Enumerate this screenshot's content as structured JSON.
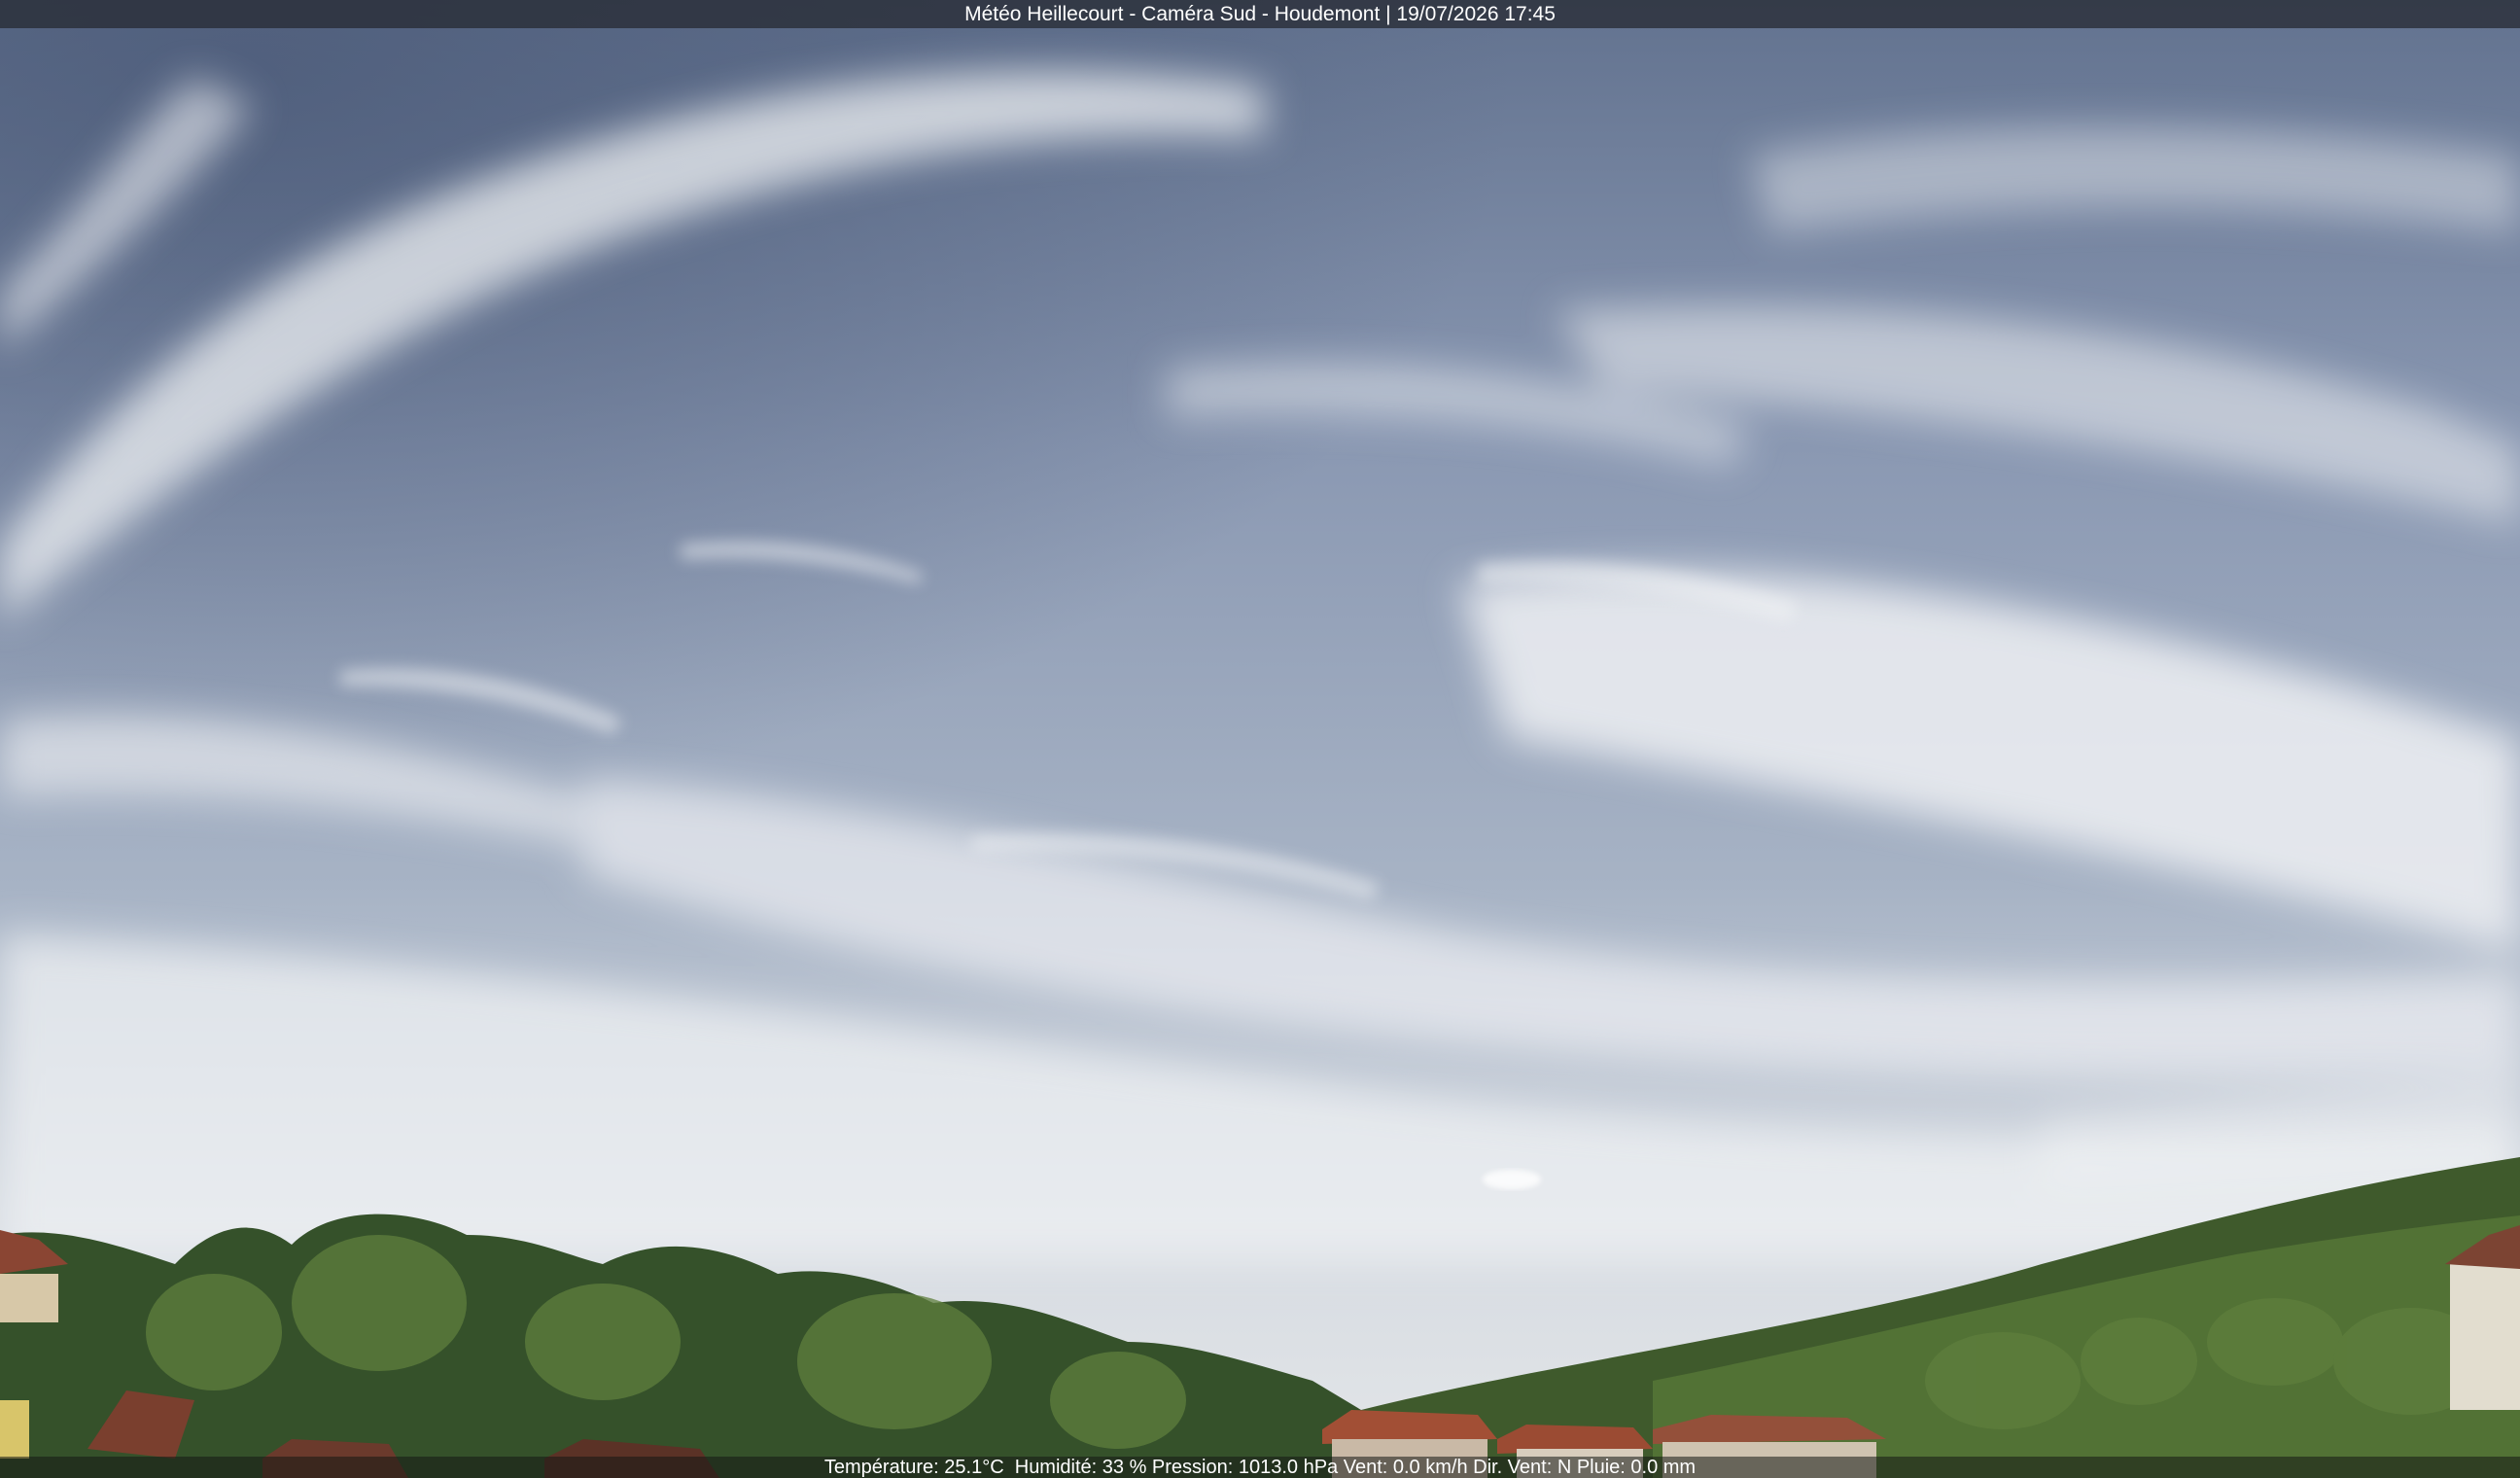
{
  "overlay": {
    "title": "Météo Heillecourt - Caméra Sud - Houdemont | 19/07/2026 17:45",
    "weather_line": "Température: 25.1°C  Humidité: 33 % Pression: 1013.0 hPa Vent: 0.0 km/h Dir. Vent: N Pluie: 0.0 mm"
  },
  "colors": {
    "sky_top": "#6f7f9c",
    "sky_mid": "#8c9bb6",
    "sky_horizon": "#d6dbe2",
    "cloud": "#e9ecef",
    "trees_dark": "#2f4a22",
    "trees_light": "#5d7f3a",
    "roof": "#9a4a32"
  }
}
